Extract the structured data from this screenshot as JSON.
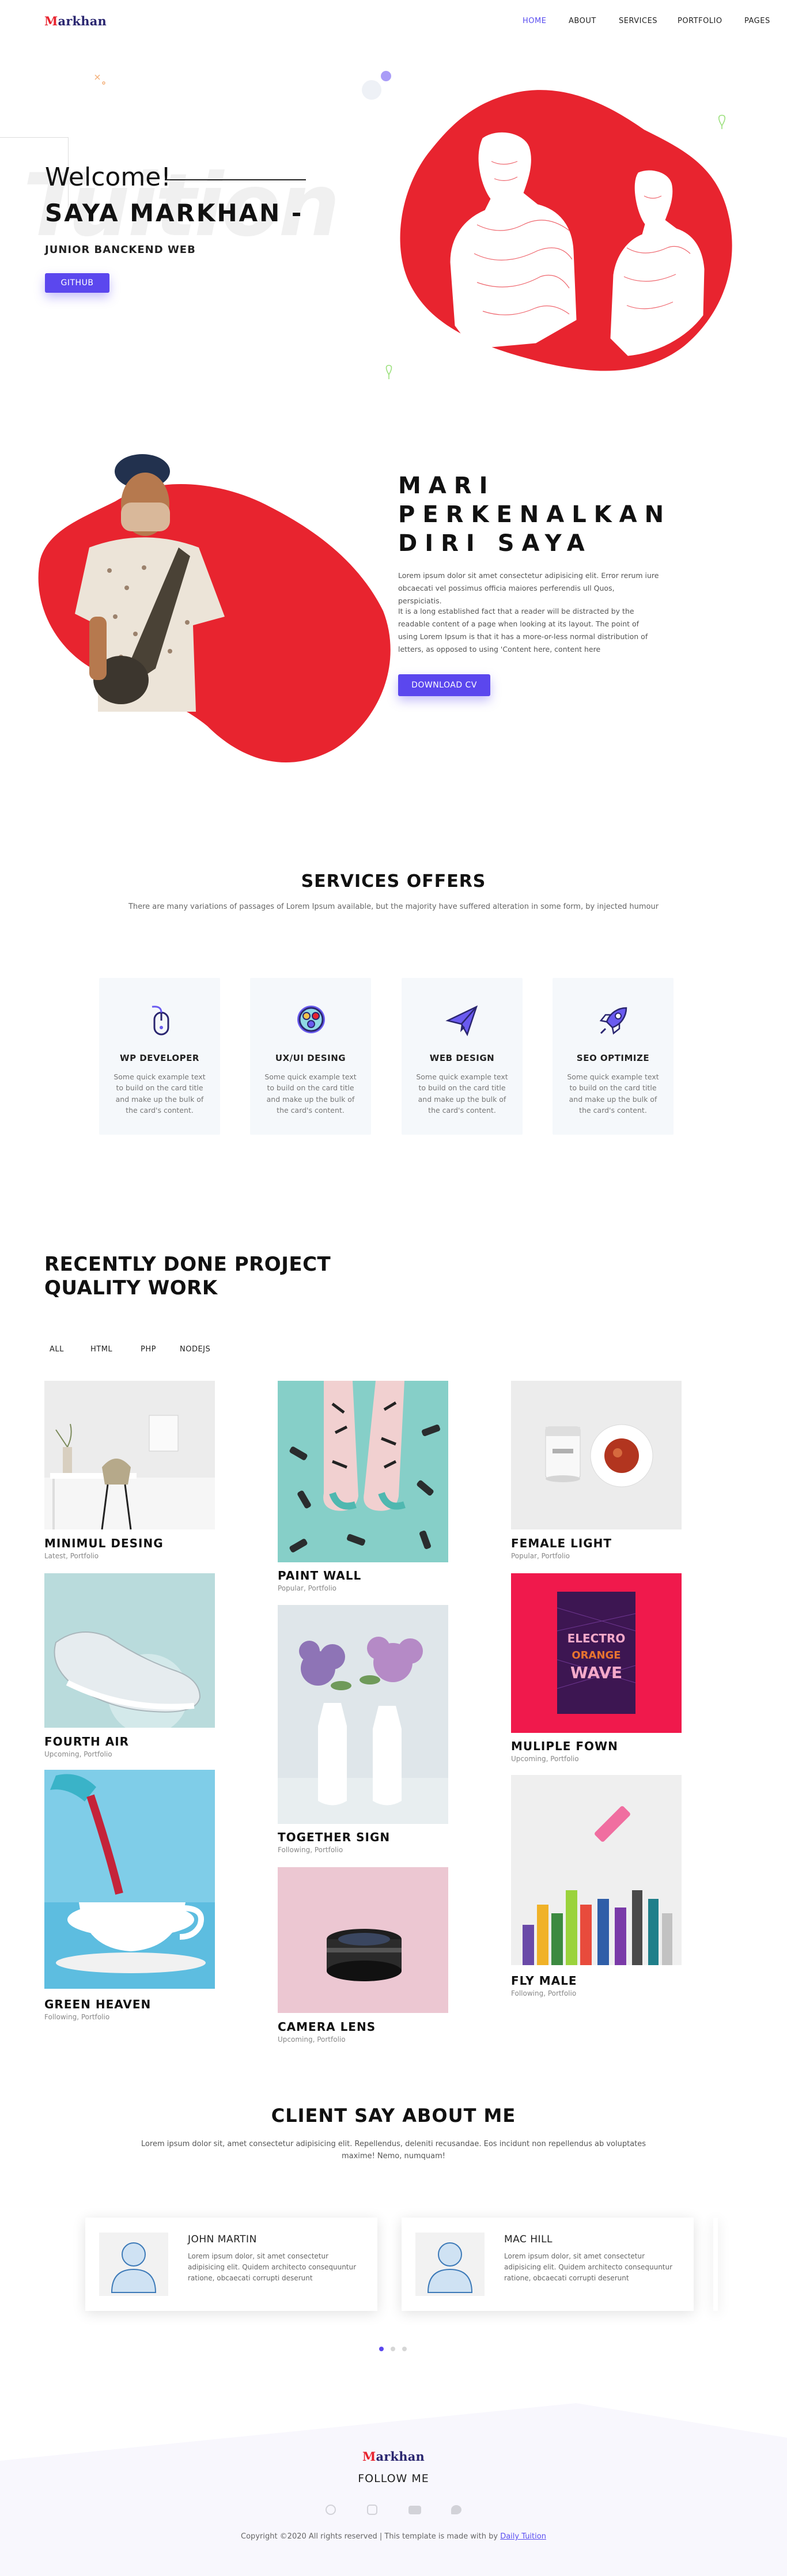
{
  "brand": {
    "logo_first": "M",
    "logo_rest": "arkhan"
  },
  "nav": {
    "items": [
      {
        "label": "HOME",
        "active": true
      },
      {
        "label": "ABOUT",
        "active": false
      },
      {
        "label": "SERVICES",
        "active": false
      },
      {
        "label": "PORTFOLIO",
        "active": false
      },
      {
        "label": "PAGES",
        "active": false
      }
    ]
  },
  "hero": {
    "ghost_text": "Tuition",
    "welcome": "Welcome!",
    "name": "SAYA MARKHAN -",
    "role": "JUNIOR BANCKEND WEB",
    "button": "GITHUB"
  },
  "about": {
    "title_lines": [
      "MARI",
      "PERKENALKAN",
      "DIRI SAYA"
    ],
    "para1": "Lorem ipsum dolor sit amet consectetur adipisicing elit. Error rerum iure obcaecati vel possimus officia maiores perferendis ull Quos, perspiciatis.",
    "para2": "It is a long established fact that a reader will be distracted by the readable content of a page when looking at its layout. The point of using Lorem Ipsum is that it has a more-or-less normal distribution of letters, as opposed to using 'Content here, content here",
    "button": "DOWNLOAD CV"
  },
  "services": {
    "title": "SERVICES OFFERS",
    "subtitle": "There are many variations of passages of Lorem Ipsum available, but the majority have suffered alteration in some form, by injected humour",
    "cards": [
      {
        "title": "WP DEVELOPER",
        "text": "Some quick example text to build on the card title and make up the bulk of the card's content.",
        "icon": "mouse-icon"
      },
      {
        "title": "UX/UI DESING",
        "text": "Some quick example text to build on the card title and make up the bulk of the card's content.",
        "icon": "palette-icon"
      },
      {
        "title": "WEB DESIGN",
        "text": "Some quick example text to build on the card title and make up the bulk of the card's content.",
        "icon": "paper-plane-icon"
      },
      {
        "title": "SEO OPTIMIZE",
        "text": "Some quick example text to build on the card title and make up the bulk of the card's content.",
        "icon": "rocket-icon"
      }
    ]
  },
  "portfolio": {
    "title_line1": "RECENTLY DONE PROJECT",
    "title_line2": "QUALITY WORK",
    "filters": [
      "ALL",
      "HTML",
      "PHP",
      "NODEJS"
    ],
    "projects": [
      {
        "title": "MINIMUL DESING",
        "meta": "Latest, Portfolio"
      },
      {
        "title": "FOURTH AIR",
        "meta": "Upcoming, Portfolio"
      },
      {
        "title": "GREEN HEAVEN",
        "meta": "Following, Portfolio"
      },
      {
        "title": "PAINT WALL",
        "meta": "Popular, Portfolio"
      },
      {
        "title": "TOGETHER SIGN",
        "meta": "Following, Portfolio"
      },
      {
        "title": "CAMERA LENS",
        "meta": "Upcoming, Portfolio"
      },
      {
        "title": "FEMALE LIGHT",
        "meta": "Popular, Portfolio"
      },
      {
        "title": "MULIPLE FOWN",
        "meta": "Upcoming, Portfolio"
      },
      {
        "title": "FLY MALE",
        "meta": "Following, Portfolio"
      }
    ]
  },
  "testimonials": {
    "title": "CLIENT SAY ABOUT ME",
    "subtitle": "Lorem ipsum dolor sit, amet consectetur adipisicing elit. Repellendus, deleniti recusandae. Eos incidunt non repellendus ab voluptates maxime! Nemo, numquam!",
    "items": [
      {
        "name": "JOHN MARTIN",
        "text": "Lorem ipsum dolor, sit amet consectetur adipisicing elit. Quidem architecto consequuntur ratione, obcaecati corrupti deserunt"
      },
      {
        "name": "MAC HILL",
        "text": "Lorem ipsum dolor, sit amet consectetur adipisicing elit. Quidem architecto consequuntur ratione, obcaecati corrupti deserunt"
      }
    ]
  },
  "footer": {
    "logo_first": "M",
    "logo_rest": "arkhan",
    "follow": "FOLLOW ME",
    "copyright": "Copyright ©2020 All rights reserved | This template is made with by",
    "credit": "Daily Tuition"
  },
  "colors": {
    "accent": "#5b47ee",
    "brand_red": "#e8242f",
    "logo_navy": "#2a2670"
  }
}
